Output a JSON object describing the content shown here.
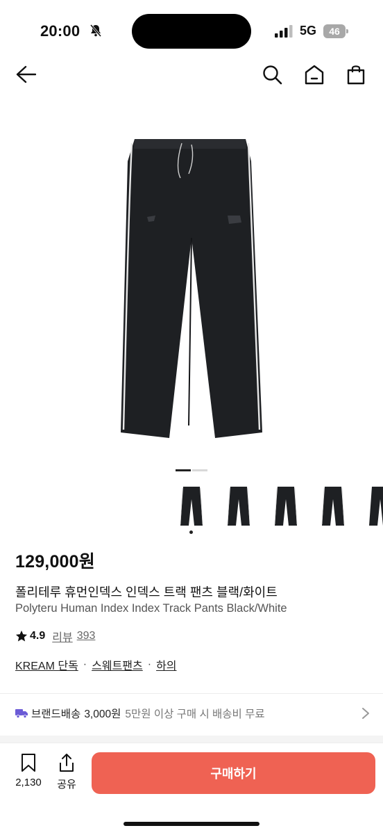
{
  "status_bar": {
    "time": "20:00",
    "network": "5G",
    "battery": "46"
  },
  "product": {
    "price": "129,000원",
    "name_ko": "폴리테루 휴먼인덱스 인덱스 트랙 팬츠 블랙/화이트",
    "name_en": "Polyteru Human Index Index Track Pants Black/White",
    "rating": "4.9",
    "review_label": "리뷰",
    "review_count": "393",
    "tags": [
      "KREAM 단독",
      "스웨트팬츠",
      "하의"
    ],
    "tag_separator": "·"
  },
  "image_carousel": {
    "total_pages": 2,
    "current_page": 1,
    "thumbnails": 5
  },
  "shipping": {
    "label": "브랜드배송",
    "fee": "3,000원",
    "note": "5만원 이상 구매 시 배송비 무료"
  },
  "bottom_bar": {
    "wish_count": "2,130",
    "share_label": "공유",
    "buy_label": "구매하기"
  },
  "colors": {
    "accent": "#ef6253",
    "truck_icon": "#6b5bd6",
    "pants": "#1e2023",
    "piping": "#e8e8e8"
  },
  "icons": [
    "bell-slash-icon",
    "signal-icon",
    "battery-icon",
    "back-arrow-icon",
    "search-icon",
    "home-icon",
    "shopping-bag-icon",
    "star-icon",
    "truck-icon",
    "chevron-right-icon",
    "bookmark-icon",
    "share-icon"
  ]
}
